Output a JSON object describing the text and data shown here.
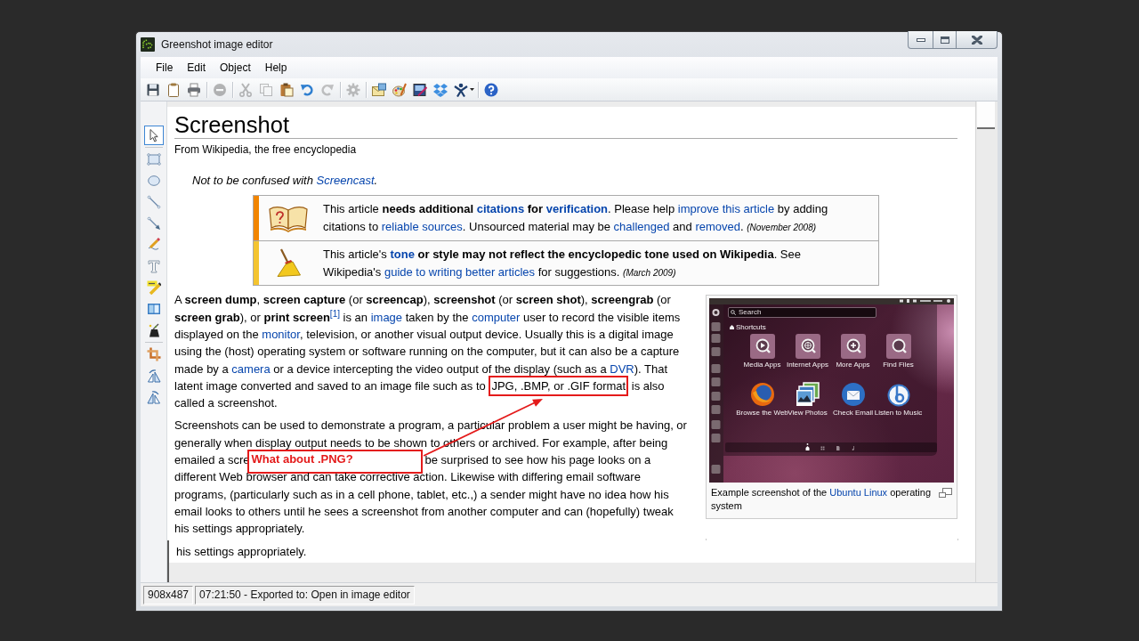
{
  "window": {
    "title": "Greenshot image editor",
    "controls": [
      {
        "kind": "minimize"
      },
      {
        "kind": "maximize"
      },
      {
        "kind": "close"
      }
    ]
  },
  "menu": [
    "File",
    "Edit",
    "Object",
    "Help"
  ],
  "toolbar": {
    "groups": [
      [
        {
          "kind": "save",
          "disabled": false
        },
        {
          "kind": "clipboard",
          "disabled": false
        },
        {
          "kind": "print",
          "disabled": false
        }
      ],
      [
        {
          "kind": "delete",
          "disabled": true
        }
      ],
      [
        {
          "kind": "cut",
          "disabled": true
        },
        {
          "kind": "copy",
          "disabled": true
        },
        {
          "kind": "paste",
          "disabled": false
        },
        {
          "kind": "undo",
          "disabled": false
        },
        {
          "kind": "redo",
          "disabled": true
        }
      ],
      [
        {
          "kind": "settings",
          "disabled": true
        }
      ],
      [
        {
          "kind": "email",
          "disabled": false
        },
        {
          "kind": "paint",
          "disabled": false
        },
        {
          "kind": "editor",
          "disabled": false
        },
        {
          "kind": "diamonds",
          "disabled": false
        },
        {
          "kind": "figure",
          "disabled": false,
          "dropdown": true
        }
      ],
      [
        {
          "kind": "help",
          "disabled": false
        }
      ]
    ]
  },
  "tools": {
    "groups": [
      [
        {
          "kind": "pointer",
          "selected": true
        }
      ],
      [
        {
          "kind": "rectangle",
          "selected": false
        },
        {
          "kind": "ellipse",
          "selected": false
        },
        {
          "kind": "line",
          "selected": false
        },
        {
          "kind": "arrow",
          "selected": false
        },
        {
          "kind": "freehand",
          "selected": false
        },
        {
          "kind": "text",
          "selected": false
        },
        {
          "kind": "highlight",
          "selected": false
        },
        {
          "kind": "obfuscate",
          "selected": false
        },
        {
          "kind": "effects",
          "selected": false
        }
      ],
      [
        {
          "kind": "crop",
          "selected": false
        },
        {
          "kind": "rotate_cw",
          "selected": false
        },
        {
          "kind": "rotate_ccw",
          "selected": false
        }
      ]
    ]
  },
  "document": {
    "title": "Screenshot",
    "subtitle": "From Wikipedia, the free encyclopedia",
    "hatnote": [
      {
        "kind": "text",
        "text": "Not to be confused with "
      },
      {
        "kind": "link",
        "text": "Screencast"
      },
      {
        "kind": "text",
        "text": "."
      }
    ],
    "notices": [
      {
        "kind": "book",
        "color": "#f28500",
        "segments": [
          {
            "kind": "text",
            "text": "This article "
          },
          {
            "kind": "bold",
            "text": "needs additional "
          },
          {
            "kind": "bold_link",
            "text": "citations"
          },
          {
            "kind": "bold",
            "text": " for "
          },
          {
            "kind": "bold_link",
            "text": "verification"
          },
          {
            "kind": "text",
            "text": ". Please help "
          },
          {
            "kind": "link",
            "text": "improve this article"
          },
          {
            "kind": "text",
            "text": " by adding citations to "
          },
          {
            "kind": "link",
            "text": "reliable sources"
          },
          {
            "kind": "text",
            "text": ". Unsourced material may be "
          },
          {
            "kind": "link",
            "text": "challenged"
          },
          {
            "kind": "text",
            "text": " and "
          },
          {
            "kind": "link",
            "text": "removed"
          },
          {
            "kind": "text",
            "text": ". "
          },
          {
            "kind": "date",
            "text": "(November 2008)"
          }
        ]
      },
      {
        "kind": "broom",
        "color": "#f4c430",
        "segments": [
          {
            "kind": "text",
            "text": "This article's "
          },
          {
            "kind": "bold_link",
            "text": "tone"
          },
          {
            "kind": "bold",
            "text": " or style may not reflect the encyclopedic tone used on Wikipedia"
          },
          {
            "kind": "text",
            "text": ". See Wikipedia's "
          },
          {
            "kind": "link",
            "text": "guide to writing better articles"
          },
          {
            "kind": "text",
            "text": " for suggestions. "
          },
          {
            "kind": "date",
            "text": "(March 2009)"
          }
        ]
      }
    ],
    "paragraphs": [
      {
        "kind": "text",
        "segments": [
          {
            "kind": "text",
            "text": "A "
          },
          {
            "kind": "bold",
            "text": "screen dump"
          },
          {
            "kind": "text",
            "text": ", "
          },
          {
            "kind": "bold",
            "text": "screen capture"
          },
          {
            "kind": "text",
            "text": " (or "
          },
          {
            "kind": "bold",
            "text": "screencap"
          },
          {
            "kind": "text",
            "text": "), "
          },
          {
            "kind": "bold",
            "text": "screenshot"
          },
          {
            "kind": "text",
            "text": " (or "
          },
          {
            "kind": "bold",
            "text": "screen shot"
          },
          {
            "kind": "text",
            "text": "), "
          },
          {
            "kind": "bold",
            "text": "screengrab"
          },
          {
            "kind": "text",
            "text": " (or "
          },
          {
            "kind": "bold",
            "text": "screen grab"
          },
          {
            "kind": "text",
            "text": "), or "
          },
          {
            "kind": "bold",
            "text": "print screen"
          },
          {
            "kind": "ref",
            "text": "[1]"
          },
          {
            "kind": "text",
            "text": " is an "
          },
          {
            "kind": "link",
            "text": "image"
          },
          {
            "kind": "text",
            "text": " taken by the "
          },
          {
            "kind": "link",
            "text": "computer"
          },
          {
            "kind": "text",
            "text": " user to record the visible items displayed on the "
          },
          {
            "kind": "link",
            "text": "monitor"
          },
          {
            "kind": "text",
            "text": ", television, or another visual output device. Usually this is a digital image using the (host) operating system or software running on the computer, but it can also be a capture made by a "
          },
          {
            "kind": "link",
            "text": "camera"
          },
          {
            "kind": "text",
            "text": " or a device intercepting the video output of the display (such as a "
          },
          {
            "kind": "link",
            "text": "DVR"
          },
          {
            "kind": "text",
            "text": "). That latent image converted and saved to an image file such as to "
          },
          {
            "kind": "highlight",
            "text": "JPG, .BMP, or .GIF format"
          },
          {
            "kind": "text",
            "text": " is also called a screenshot."
          }
        ]
      },
      {
        "kind": "annotated",
        "above": [
          "Screenshots can be used to demonstrate a program, a particular problem a user might be having, or",
          "generally when display output needs to be shown to others or archived. For example, after being"
        ],
        "left": "emailed a scre",
        "callout": "What about .PNG?",
        "right": "be surprised to see how his page looks on a",
        "below": "different Web browser and can take corrective action. Likewise with differing email software programs, (particularly such as in a cell phone, tablet, etc.,) a sender might have no idea how his email looks to others until he sees a screenshot from another computer and can (hopefully) tweak his settings appropriately."
      }
    ],
    "figure": {
      "screen": {
        "search": {
          "placeholder": "Search"
        },
        "section": "Shortcuts",
        "tiles": [
          {
            "kind": "play",
            "label": "Media Apps"
          },
          {
            "kind": "globe",
            "label": "Internet Apps"
          },
          {
            "kind": "plus",
            "label": "More Apps"
          },
          {
            "kind": "magnifier",
            "label": "Find Files"
          }
        ],
        "apps": [
          {
            "kind": "browser",
            "label": "Browse the Web"
          },
          {
            "kind": "photos",
            "label": "View Photos"
          },
          {
            "kind": "mail",
            "label": "Check Email"
          },
          {
            "kind": "music",
            "label": "Listen to Music"
          }
        ],
        "filters": [
          {
            "kind": "home",
            "selected": true
          },
          {
            "kind": "apps",
            "selected": false
          },
          {
            "kind": "files",
            "selected": false
          },
          {
            "kind": "music",
            "selected": false
          }
        ]
      },
      "caption": [
        {
          "kind": "text",
          "text": "Example screenshot of the "
        },
        {
          "kind": "link",
          "text": "Ubuntu Linux"
        },
        {
          "kind": "text",
          "text": " operating system"
        }
      ]
    }
  },
  "canvas_strip": {
    "text": "his settings appropriately."
  },
  "status_bar": [
    "908x487",
    "07:21:50 - Exported to: Open in image editor"
  ]
}
